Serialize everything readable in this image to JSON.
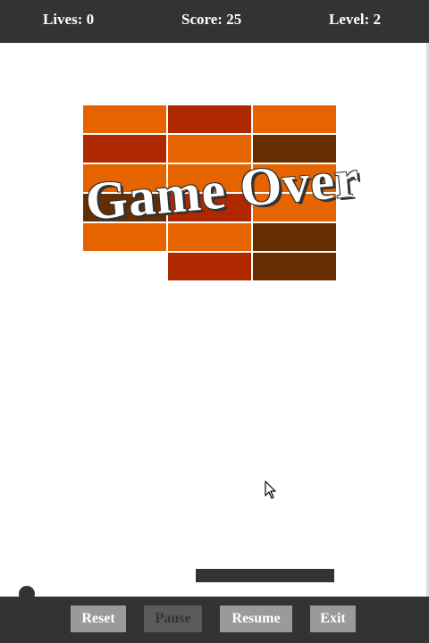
{
  "hud": {
    "lives": "Lives: 0",
    "score": "Score: 25",
    "level": "Level: 2"
  },
  "overlay": {
    "message": "Game Over"
  },
  "colors": {
    "bar": "#333333",
    "brick_orange": "#e66400",
    "brick_red": "#b02800",
    "brick_brown": "#662e00",
    "button": "#9a9a9a",
    "button_disabled": "#5a5a5a"
  },
  "bricks": {
    "rows": 6,
    "cols": 3,
    "grid": [
      [
        "orange",
        "red",
        "orange"
      ],
      [
        "red",
        "orange",
        "brown"
      ],
      [
        "orange",
        "orange",
        "orange"
      ],
      [
        "brown",
        "red",
        "orange"
      ],
      [
        "orange",
        "orange",
        "brown"
      ],
      [
        null,
        "red",
        "brown"
      ]
    ]
  },
  "controls": {
    "reset": "Reset",
    "pause": "Pause",
    "resume": "Resume",
    "exit": "Exit"
  },
  "icons": {
    "cursor": "mouse-pointer-icon",
    "ball": "ball-icon"
  }
}
